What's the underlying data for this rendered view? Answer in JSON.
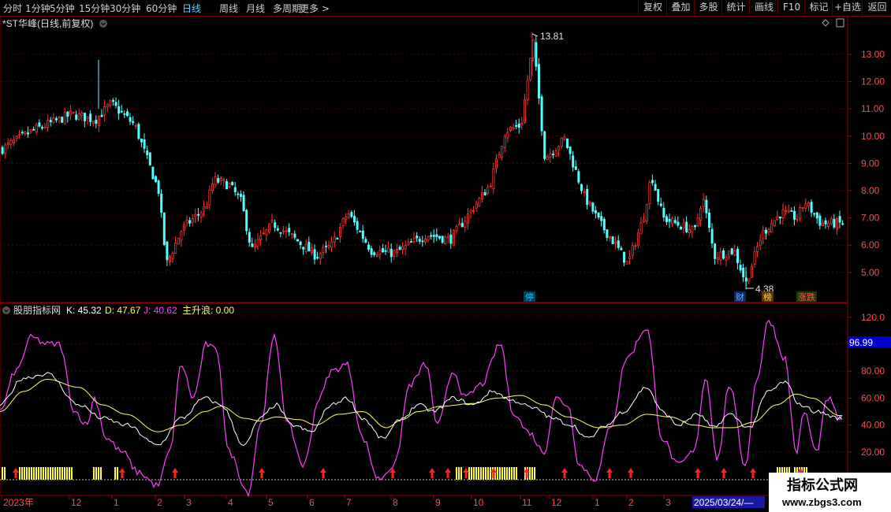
{
  "toolbar": {
    "periods": [
      "分时",
      "1分钟",
      "5分钟",
      "15分钟",
      "30分钟",
      "60分钟",
      "日线",
      "周线",
      "月线",
      "多周期",
      "更多 >"
    ],
    "active_index": 6,
    "right_buttons": [
      "复权",
      "叠加",
      "多股",
      "统计",
      "画线",
      "F10",
      "标记",
      "+自选",
      "返回"
    ]
  },
  "main_panel": {
    "title": "*ST华峰(日线,前复权)",
    "high_label": "13.81",
    "low_label": "4.38",
    "y_ticks": [
      "13.00",
      "12.00",
      "11.00",
      "10.00",
      "9.00",
      "8.00",
      "7.00",
      "6.00",
      "5.00"
    ],
    "event_tags": [
      {
        "text": "停",
        "color": "#00c8ff"
      },
      {
        "text": "财",
        "color": "#3a7bff"
      },
      {
        "text": "榜",
        "color": "#ffcc33"
      },
      {
        "text": "涨跌",
        "color": "#ff4444"
      }
    ],
    "colors": {
      "up": "#ff3232",
      "down": "#54ffff",
      "grid": "#6a0000"
    }
  },
  "indicator_panel": {
    "name": "股朋指标网",
    "k_label": "K: 45.32",
    "d_label": "D: 47.67",
    "j_label": "J: 40.62",
    "wave_label": "主升浪: 0.00",
    "current_value": "96.99",
    "y_ticks": [
      "120.0",
      "100.0",
      "80.00",
      "60.00",
      "40.00",
      "20.00"
    ],
    "colors": {
      "k": "#ffffff",
      "d": "#ffff66",
      "j": "#ff40ff",
      "bar": "#ffff33",
      "arrow": "#ff2020"
    }
  },
  "date_axis": {
    "labels": [
      "2023年",
      "12",
      "1",
      "2",
      "3",
      "4",
      "5",
      "6",
      "7",
      "8",
      "9",
      "10",
      "11",
      "12",
      "1",
      "2",
      "3"
    ],
    "current_date": "2025/03/24/—"
  },
  "watermark": {
    "title": "指标公式网",
    "url": "www.zbgs3.com"
  }
}
